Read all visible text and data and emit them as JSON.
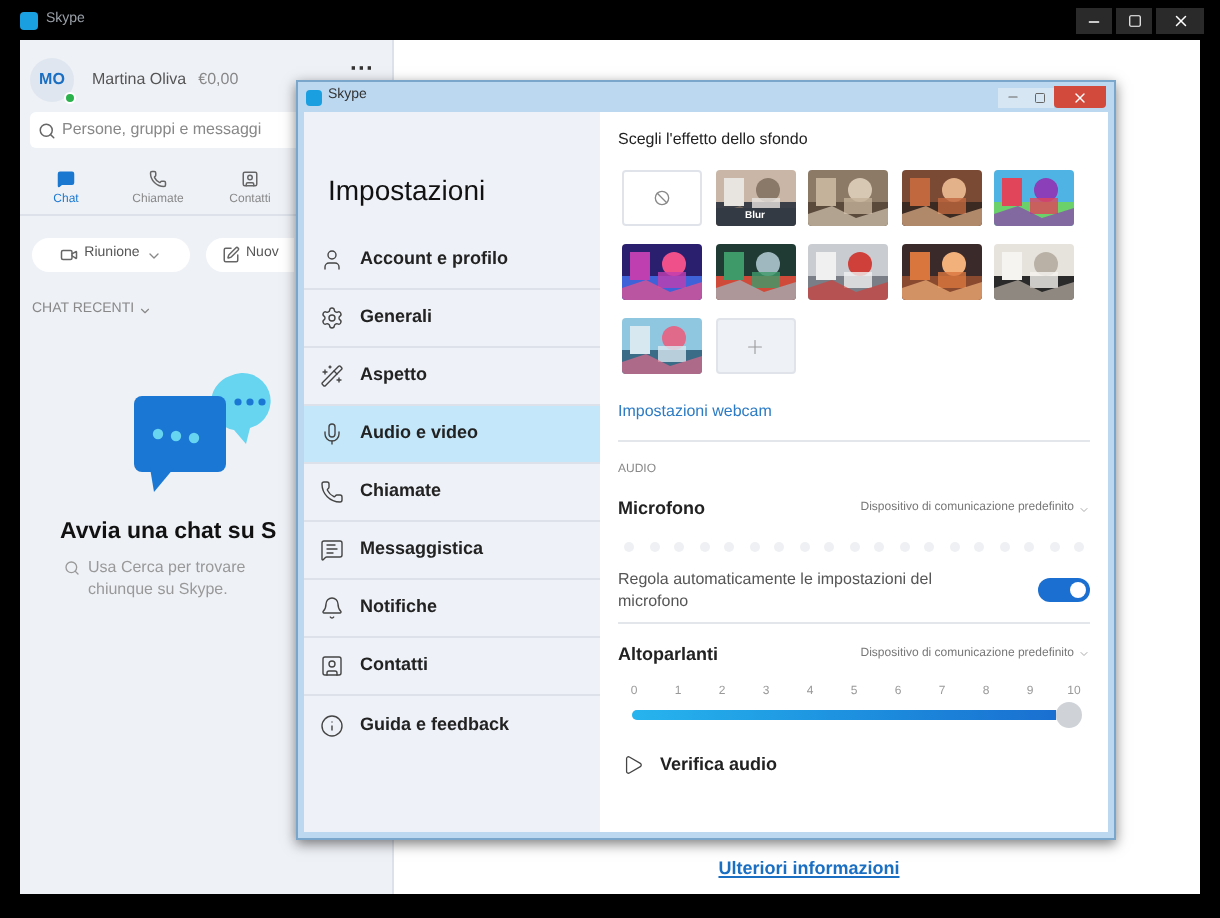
{
  "main_window": {
    "title": "Skype"
  },
  "profile": {
    "initials": "MO",
    "name": "Martina Oliva",
    "credit": "€0,00",
    "online": true,
    "more": "···"
  },
  "search": {
    "placeholder": "Persone, gruppi e messaggi"
  },
  "nav_tabs": [
    {
      "label": "Chat",
      "selected": true
    },
    {
      "label": "Chiamate",
      "selected": false
    },
    {
      "label": "Contatti",
      "selected": false
    }
  ],
  "actions": [
    {
      "label": "Riunione"
    },
    {
      "label": "Nuov"
    }
  ],
  "recent_header": "CHAT RECENTI",
  "empty_state": {
    "title": "Avvia una chat su S",
    "hint": "Usa Cerca per trovare chiunque su Skype."
  },
  "more_link": "Ulteriori informazioni",
  "dialog": {
    "title": "Skype",
    "heading": "Impostazioni",
    "menu": [
      {
        "label": "Account e profilo",
        "selected": false
      },
      {
        "label": "Generali",
        "selected": false
      },
      {
        "label": "Aspetto",
        "selected": false
      },
      {
        "label": "Audio e video",
        "selected": true
      },
      {
        "label": "Chiamate",
        "selected": false
      },
      {
        "label": "Messaggistica",
        "selected": false
      },
      {
        "label": "Notifiche",
        "selected": false
      },
      {
        "label": "Contatti",
        "selected": false
      },
      {
        "label": "Guida e feedback",
        "selected": false
      }
    ],
    "background_title": "Scegli l'effetto dello sfondo",
    "backgrounds": [
      {
        "kind": "none"
      },
      {
        "kind": "picture",
        "label": "Blur"
      },
      {
        "kind": "picture"
      },
      {
        "kind": "picture"
      },
      {
        "kind": "picture"
      },
      {
        "kind": "picture"
      },
      {
        "kind": "picture"
      },
      {
        "kind": "picture"
      },
      {
        "kind": "picture"
      },
      {
        "kind": "picture"
      },
      {
        "kind": "picture"
      },
      {
        "kind": "add"
      }
    ],
    "webcam_link": "Impostazioni webcam",
    "audio_header": "AUDIO",
    "microphone": {
      "label": "Microfono",
      "device": "Dispositivo di comunicazione predefinito"
    },
    "auto_adjust": {
      "label": "Regola automaticamente le impostazioni del microfono",
      "on": true
    },
    "speakers": {
      "label": "Altoparlanti",
      "device": "Dispositivo di comunicazione predefinito",
      "ticks": [
        "0",
        "1",
        "2",
        "3",
        "4",
        "5",
        "6",
        "7",
        "8",
        "9",
        "10"
      ],
      "level": 1
    },
    "test_audio": "Verifica audio"
  }
}
